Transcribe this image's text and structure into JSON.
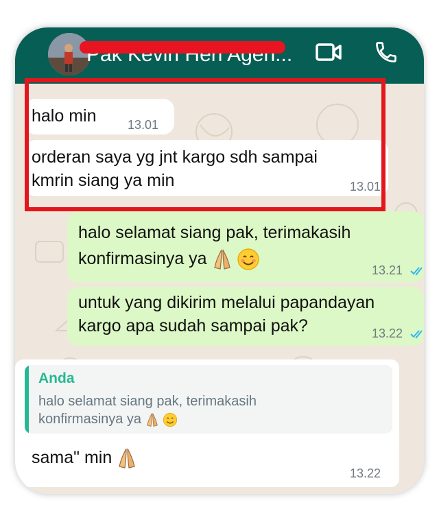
{
  "header": {
    "contact_name": "Pak Kevin Herl Agen...",
    "video_icon": "video-call-icon",
    "phone_icon": "phone-call-icon"
  },
  "messages": [
    {
      "text": "halo min",
      "time": "13.01",
      "direction": "incoming"
    },
    {
      "line1": "orderan saya yg jnt kargo sdh sampai",
      "line2": "kmrin siang ya min",
      "time": "13.01",
      "direction": "incoming"
    },
    {
      "line1": "halo selamat siang pak, terimakasih",
      "line2": "konfirmasinya ya",
      "time": "13.21",
      "direction": "outgoing",
      "emoji": [
        "folded-hands",
        "smiling-face"
      ]
    },
    {
      "line1": "untuk yang dikirim melalui papandayan",
      "line2": "kargo apa sudah sampai pak?",
      "time": "13.22",
      "direction": "outgoing"
    },
    {
      "quote_author": "Anda",
      "quote_line1": "halo selamat siang pak, terimakasih",
      "quote_line2": "konfirmasinya ya",
      "text": "sama\" min",
      "time": "13.22",
      "direction": "incoming"
    }
  ],
  "colors": {
    "header": "#075e54",
    "incoming": "#ffffff",
    "outgoing": "#dcf8c6",
    "highlight": "#e3151d",
    "reply_author": "#25b993",
    "redaction": "#e81422"
  }
}
